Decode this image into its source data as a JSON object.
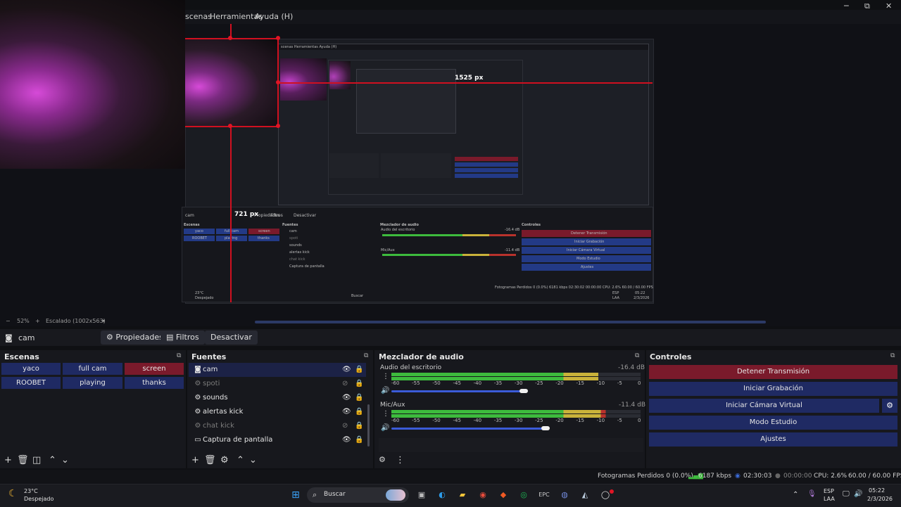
{
  "menu": {
    "scenes": "scenas",
    "tools": "Herramientas",
    "help": "Ayuda (H)"
  },
  "window_controls": {
    "minimize": "─",
    "maximize": "⧉",
    "close": "✕"
  },
  "preview": {
    "width_label": "1525 px",
    "height_label": "721 px",
    "zoom": "52%",
    "scaled": "Escalado (1002x563)"
  },
  "nested_window": {
    "menu_text": "scenas   Herramientas   Ayuda (H)",
    "scene_label": "cam",
    "properties": "Propiedades",
    "filters": "Filtros",
    "deactivate": "Desactivar",
    "scenes_title": "Escenas",
    "sources_title": "Fuentes",
    "mixer_title": "Mezclador de audio",
    "controls_title": "Controles",
    "scenes": [
      {
        "label": "yaco"
      },
      {
        "label": "full cam"
      },
      {
        "label": "screen"
      },
      {
        "label": "ROOBET"
      },
      {
        "label": "playing"
      },
      {
        "label": "thanks"
      }
    ],
    "sources": [
      "cam",
      "spoti",
      "sounds",
      "alertas kick",
      "chat kick",
      "Captura de pantalla"
    ],
    "desktop_audio": "Audio del escritorio",
    "desktop_db": "-16.4 dB",
    "mic": "Mic/Aux",
    "mic_db": "-11.4 dB",
    "controls": [
      "Detener Transmisión",
      "Iniciar Grabación",
      "Iniciar Cámara Virtual",
      "Modo Estudio",
      "Ajustes"
    ],
    "status": "Fotogramas Perdidos 0 (0.0%)   6181 kbps   02:30:02   00:00:00   CPU: 2.6%   60.00 / 60.00 FPS",
    "weather_temp": "23°C",
    "weather_desc": "Despejado",
    "search": "Buscar",
    "tray_lang": "ESP",
    "tray_lang2": "LAA",
    "clock_time": "05:22",
    "clock_date": "2/3/2026"
  },
  "source_toolbar": {
    "scene_name": "cam",
    "properties": "Propiedades",
    "filters": "Filtros",
    "deactivate": "Desactivar"
  },
  "scenes_dock": {
    "title": "Escenas",
    "items": [
      {
        "label": "yaco",
        "active": false
      },
      {
        "label": "full cam",
        "active": false
      },
      {
        "label": "screen",
        "active": true
      },
      {
        "label": "ROOBET",
        "active": false
      },
      {
        "label": "playing",
        "active": false
      },
      {
        "label": "thanks",
        "active": false
      }
    ]
  },
  "sources_dock": {
    "title": "Fuentes",
    "items": [
      {
        "label": "cam",
        "visible": true,
        "icon": "camera-icon"
      },
      {
        "label": "spoti",
        "visible": false,
        "icon": "gear-icon"
      },
      {
        "label": "sounds",
        "visible": true,
        "icon": "gear-icon"
      },
      {
        "label": "alertas kick",
        "visible": true,
        "icon": "gear-icon"
      },
      {
        "label": "chat kick",
        "visible": false,
        "icon": "gear-icon"
      },
      {
        "label": "Captura de pantalla",
        "visible": true,
        "icon": "monitor-icon"
      }
    ]
  },
  "mixer": {
    "title": "Mezclador de audio",
    "channels": [
      {
        "name": "Audio del escritorio",
        "db": "-16.4 dB",
        "level": 0.83,
        "volume": 0.53
      },
      {
        "name": "Mic/Aux",
        "db": "-11.4 dB",
        "level": 0.86,
        "volume": 0.62
      }
    ],
    "ticks": [
      "-60",
      "-55",
      "-50",
      "-45",
      "-40",
      "-35",
      "-30",
      "-25",
      "-20",
      "-15",
      "-10",
      "-5",
      "0"
    ]
  },
  "controls": {
    "title": "Controles",
    "stop_stream": "Detener Transmisión",
    "start_recording": "Iniciar Grabación",
    "start_virtual_cam": "Iniciar Cámara Virtual",
    "studio_mode": "Modo Estudio",
    "settings": "Ajustes"
  },
  "status_bar": {
    "dropped_frames": "Fotogramas Perdidos 0 (0.0%)",
    "bitrate": "6187 kbps",
    "stream_time": "02:30:03",
    "rec_time": "00:00:00",
    "cpu": "CPU: 2.6%",
    "fps": "60.00 / 60.00 FPS"
  },
  "taskbar": {
    "weather_temp": "23°C",
    "weather_desc": "Despejado",
    "search_placeholder": "Buscar",
    "lang_top": "ESP",
    "lang_bottom": "LAA",
    "time": "05:22",
    "date": "2/3/2026"
  },
  "colors": {
    "accent_blue": "#1f2a63",
    "accent_red": "#7a1a2b",
    "guide_red": "#d01020",
    "meter_green": "#3dbb3d",
    "meter_yellow": "#c9b23a",
    "meter_red": "#b8322c"
  }
}
